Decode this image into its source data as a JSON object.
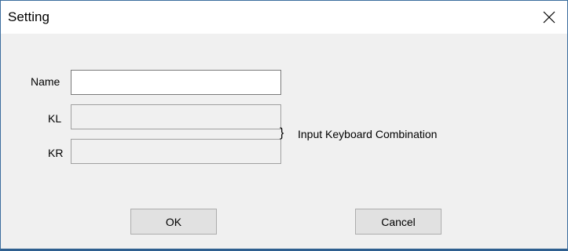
{
  "window": {
    "title": "Setting",
    "close_icon": "close-icon"
  },
  "form": {
    "name": {
      "label": "Name",
      "value": ""
    },
    "kl": {
      "label": "KL",
      "value": ""
    },
    "kr": {
      "label": "KR",
      "value": ""
    },
    "brace": "}",
    "hint": "Input Keyboard Combination"
  },
  "buttons": {
    "ok": "OK",
    "cancel": "Cancel"
  }
}
